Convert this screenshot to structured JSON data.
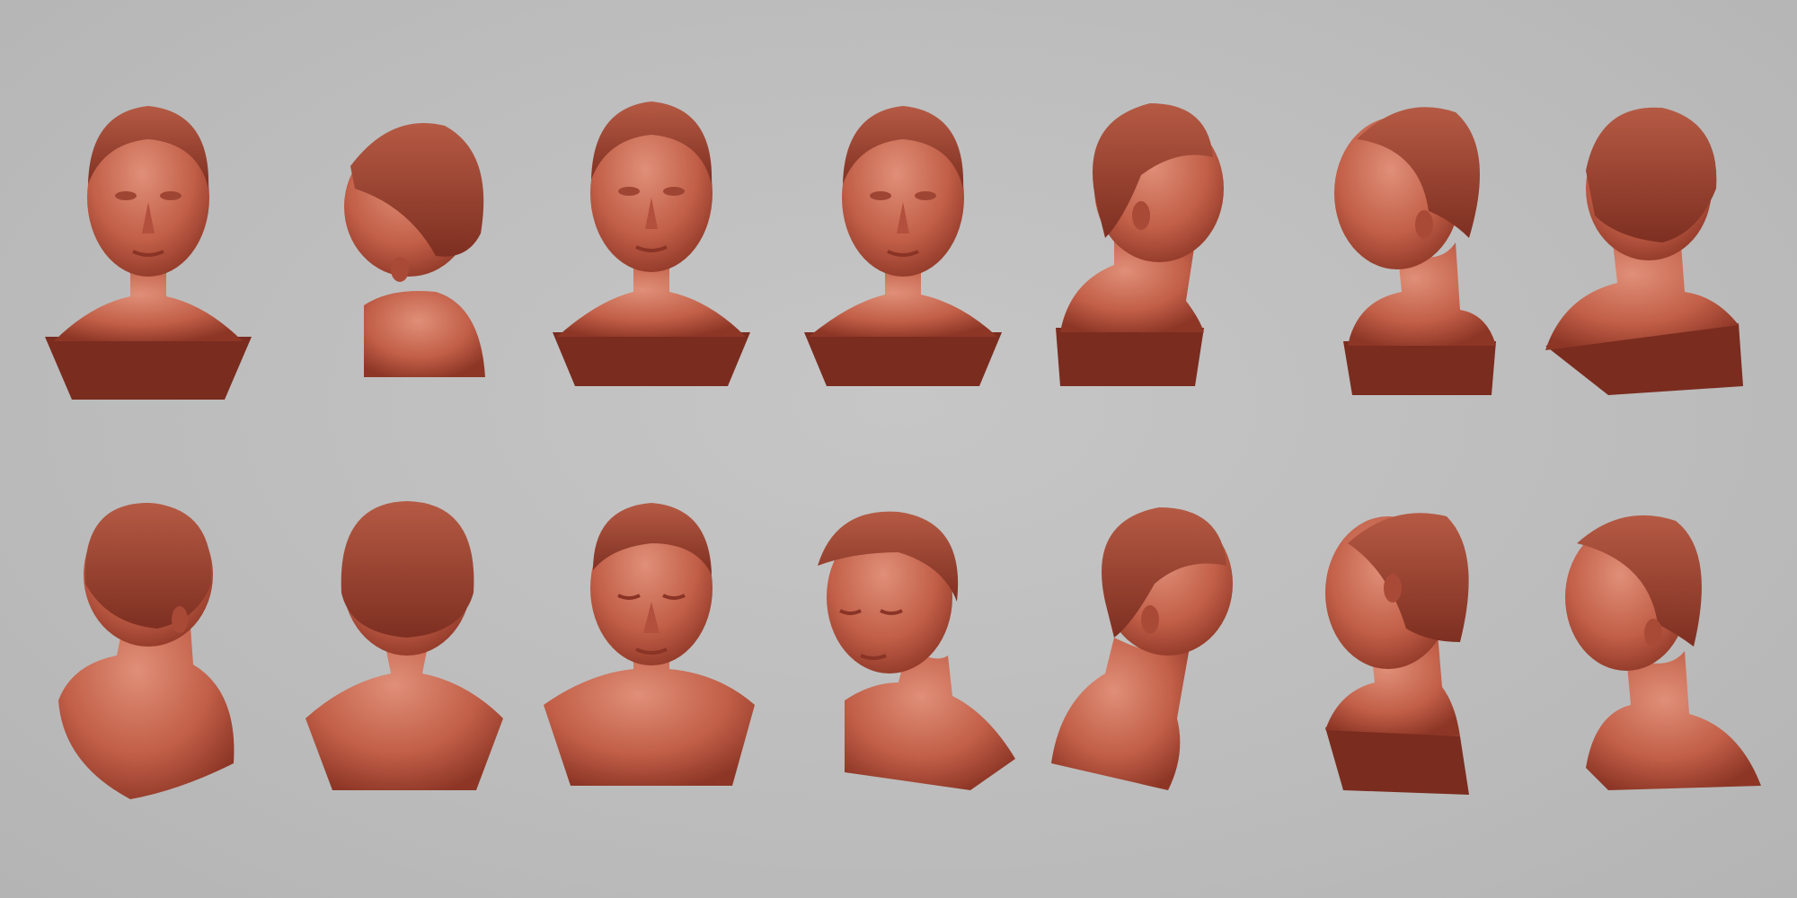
{
  "render": {
    "material_color": "#c0604a",
    "material_shadow": "#8a3426",
    "background_color": "#bdbdbd"
  },
  "rows": [
    {
      "views": [
        {
          "name": "front",
          "icon": "bust-front-icon"
        },
        {
          "name": "left-profile-turned-down",
          "icon": "bust-left-profile-icon"
        },
        {
          "name": "front",
          "icon": "bust-front-icon"
        },
        {
          "name": "front",
          "icon": "bust-front-icon"
        },
        {
          "name": "right-three-quarter-back",
          "icon": "bust-back-three-quarter-icon"
        },
        {
          "name": "left-profile",
          "icon": "bust-left-profile-icon"
        },
        {
          "name": "back-three-quarter",
          "icon": "bust-back-three-quarter-icon"
        }
      ]
    },
    {
      "views": [
        {
          "name": "back-three-quarter",
          "icon": "bust-back-three-quarter-icon"
        },
        {
          "name": "back",
          "icon": "bust-back-icon"
        },
        {
          "name": "front-looking-down",
          "icon": "bust-front-icon"
        },
        {
          "name": "three-quarter-looking-down",
          "icon": "bust-front-icon"
        },
        {
          "name": "right-three-quarter-back",
          "icon": "bust-back-three-quarter-icon"
        },
        {
          "name": "left-back-three-quarter",
          "icon": "bust-back-three-quarter-icon"
        },
        {
          "name": "left-profile",
          "icon": "bust-left-profile-icon"
        }
      ]
    }
  ]
}
